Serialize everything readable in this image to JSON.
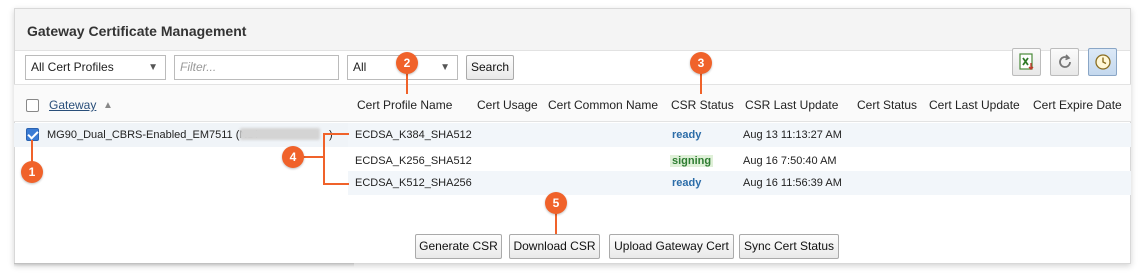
{
  "panel": {
    "title": "Gateway Certificate Management"
  },
  "toolbar": {
    "profile_select": "All Cert Profiles",
    "filter_placeholder": "Filter...",
    "scope_select": "All",
    "search_label": "Search",
    "tools": [
      "excel-export-icon",
      "refresh-icon",
      "clock-icon"
    ]
  },
  "columns": {
    "gateway": "Gateway",
    "sort_glyph": "▲",
    "cert_profile_name": "Cert Profile Name",
    "cert_usage": "Cert Usage",
    "cert_common_name": "Cert Common Name",
    "csr_status": "CSR Status",
    "csr_last_update": "CSR Last Update",
    "cert_status": "Cert Status",
    "cert_last_update": "Cert Last Update",
    "cert_expire_date": "Cert Expire Date"
  },
  "gateway": {
    "name": "MG90_Dual_CBRS-Enabled_EM7511 (NDi",
    "suffix": ")",
    "checked": true
  },
  "rows": [
    {
      "profile": "ECDSA_K384_SHA512",
      "csr_status": "ready",
      "csr_last_update": "Aug 13 11:13:27 AM"
    },
    {
      "profile": "ECDSA_K256_SHA512",
      "csr_status": "signing",
      "csr_last_update": "Aug 16 7:50:40 AM"
    },
    {
      "profile": "ECDSA_K512_SHA256",
      "csr_status": "ready",
      "csr_last_update": "Aug 16 11:56:39 AM"
    }
  ],
  "actions": {
    "generate_csr": "Generate CSR",
    "download_csr": "Download CSR",
    "upload_cert": "Upload Gateway Cert",
    "sync_status": "Sync Cert Status"
  },
  "callouts": [
    "1",
    "2",
    "3",
    "4",
    "5"
  ],
  "colors": {
    "callout": "#f0622a",
    "ready": "#2b6ca8",
    "signing": "#2e7d32",
    "checkbox": "#3a7bd5"
  }
}
